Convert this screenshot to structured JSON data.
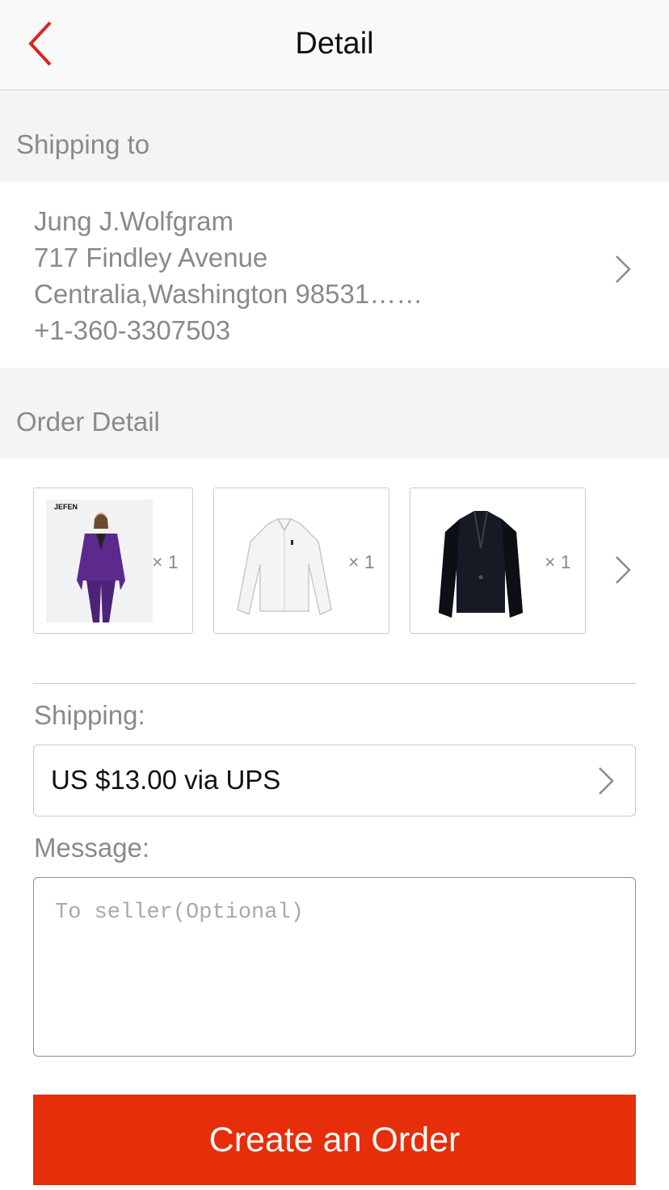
{
  "header": {
    "title": "Detail",
    "back_icon": "chevron-left-icon",
    "accent_color": "#d9251d"
  },
  "shipping_to": {
    "heading": "Shipping to",
    "address_lines": [
      "Jung J.Wolfgram",
      "717 Findley Avenue",
      "Centralia,Washington 98531……",
      "+1-360-3307503"
    ],
    "chevron_icon": "chevron-right-icon"
  },
  "order_detail": {
    "heading": "Order Detail",
    "items": [
      {
        "name": "purple suit",
        "brand_text": "JEFEN",
        "qty": "× 1"
      },
      {
        "name": "white shirt",
        "qty": "× 1"
      },
      {
        "name": "black jacket",
        "qty": "× 1"
      }
    ],
    "more_icon": "chevron-right-icon"
  },
  "shipping": {
    "label": "Shipping:",
    "value": "US $13.00 via UPS"
  },
  "message": {
    "label": "Message:",
    "placeholder": "To seller(Optional)"
  },
  "cta": {
    "label": "Create an Order",
    "color": "#e62e0b"
  }
}
